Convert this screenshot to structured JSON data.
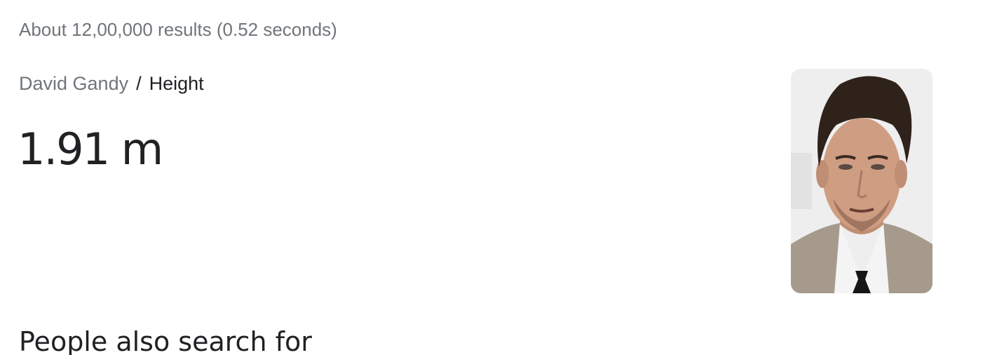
{
  "result_stats": "About 12,00,000 results (0.52 seconds)",
  "breadcrumb": {
    "entity": "David Gandy",
    "separator": "/",
    "attribute": "Height"
  },
  "answer": "1.91 m",
  "entity_image": {
    "alt": "David Gandy"
  },
  "related_heading": "People also search for",
  "colors": {
    "secondary_text": "#70757a",
    "primary_text": "#202124",
    "background": "#ffffff"
  }
}
